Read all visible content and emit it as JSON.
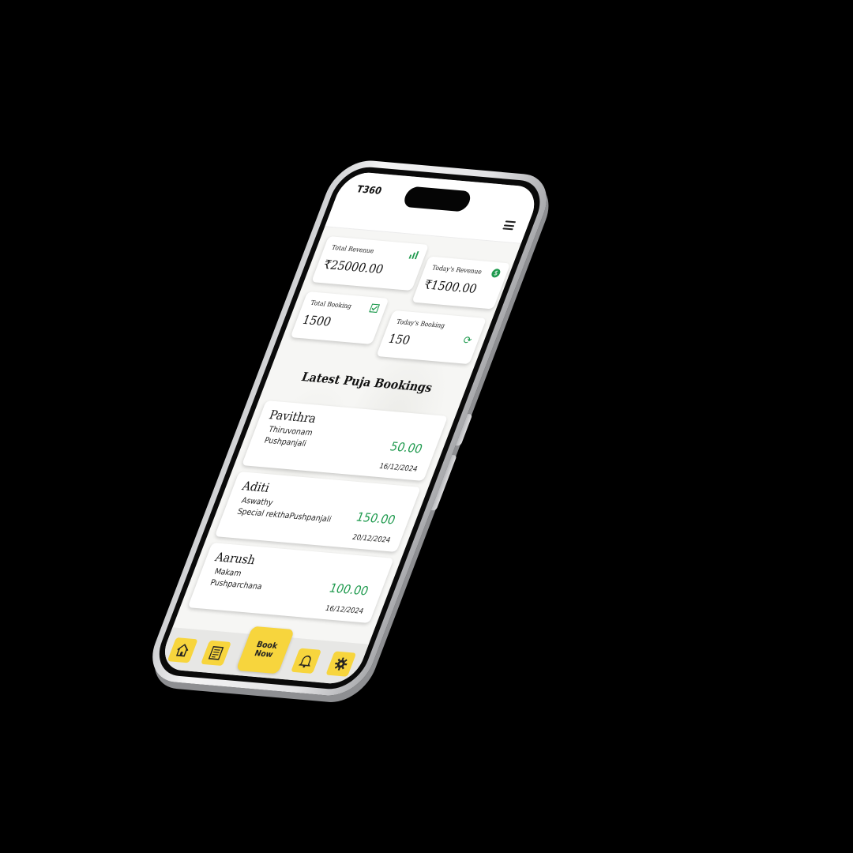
{
  "app": {
    "brand": "T360"
  },
  "stats": {
    "total_revenue": {
      "label": "Total Revenue",
      "value": "₹25000.00",
      "icon": "chart-icon"
    },
    "todays_revenue": {
      "label": "Today's Revenue",
      "value": "₹1500.00",
      "icon": "coin-icon"
    },
    "total_booking": {
      "label": "Total Booking",
      "value": "1500",
      "icon": "checkbox-icon"
    },
    "todays_booking": {
      "label": "Today's Booking",
      "value": "150",
      "icon": "refresh-icon"
    }
  },
  "bookings": {
    "title": "Latest Puja Bookings",
    "items": [
      {
        "name": "Pavithra",
        "star": "Thiruvonam",
        "puja": "Pushpanjali",
        "amount": "50.00",
        "date": "16/12/2024"
      },
      {
        "name": "Aditi",
        "star": "Aswathy",
        "puja": "Special rekthaPushpanjali",
        "amount": "150.00",
        "date": "20/12/2024"
      },
      {
        "name": "Aarush",
        "star": "Makam",
        "puja": "Pushparchana",
        "amount": "100.00",
        "date": "16/12/2024"
      }
    ]
  },
  "nav": {
    "book_now": "Book\nNow",
    "icons": [
      "home-icon",
      "document-icon",
      "bell-icon",
      "gear-icon"
    ]
  },
  "colors": {
    "accent": "#f7d53d",
    "money": "#1f9a4e",
    "background": "#000000"
  }
}
